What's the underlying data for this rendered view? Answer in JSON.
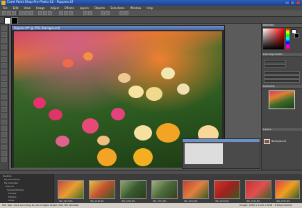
{
  "window": {
    "title": "Corel Paint Shop Pro Photo X2 - Poppies.tif"
  },
  "menu": [
    "File",
    "Edit",
    "View",
    "Image",
    "Adjust",
    "Effects",
    "Layers",
    "Objects",
    "Selections",
    "Window",
    "Help"
  ],
  "document": {
    "title": "Poppies.tif* @ 25% (Background)"
  },
  "panels": {
    "materials": "Materials",
    "learning": "Learning Center",
    "overview": "Overview",
    "layers": "Layers"
  },
  "layers": {
    "item": "Background"
  },
  "histogram": {
    "title": "Histogram"
  },
  "browser": {
    "tree": [
      "Desktop",
      "My Documents",
      "My Computer",
      "Pictures",
      "Sample Pictures",
      "Flowers",
      "Poppies",
      "Tulips"
    ],
    "thumbs": [
      "IMG_0147.JPG",
      "IMG_0148.JPG",
      "IMG_0150.JPG",
      "IMG_0151.JPG",
      "IMG_0152.JPG",
      "IMG_0153.JPG",
      "IMG_0154.JPG",
      "IMG_0155.JPG"
    ]
  },
  "status": {
    "left": "Pan Tool: Click and drag to pan images larger than the window.",
    "right": "Image: 1600 x 1200 x RGB - 8 bits/channel"
  }
}
